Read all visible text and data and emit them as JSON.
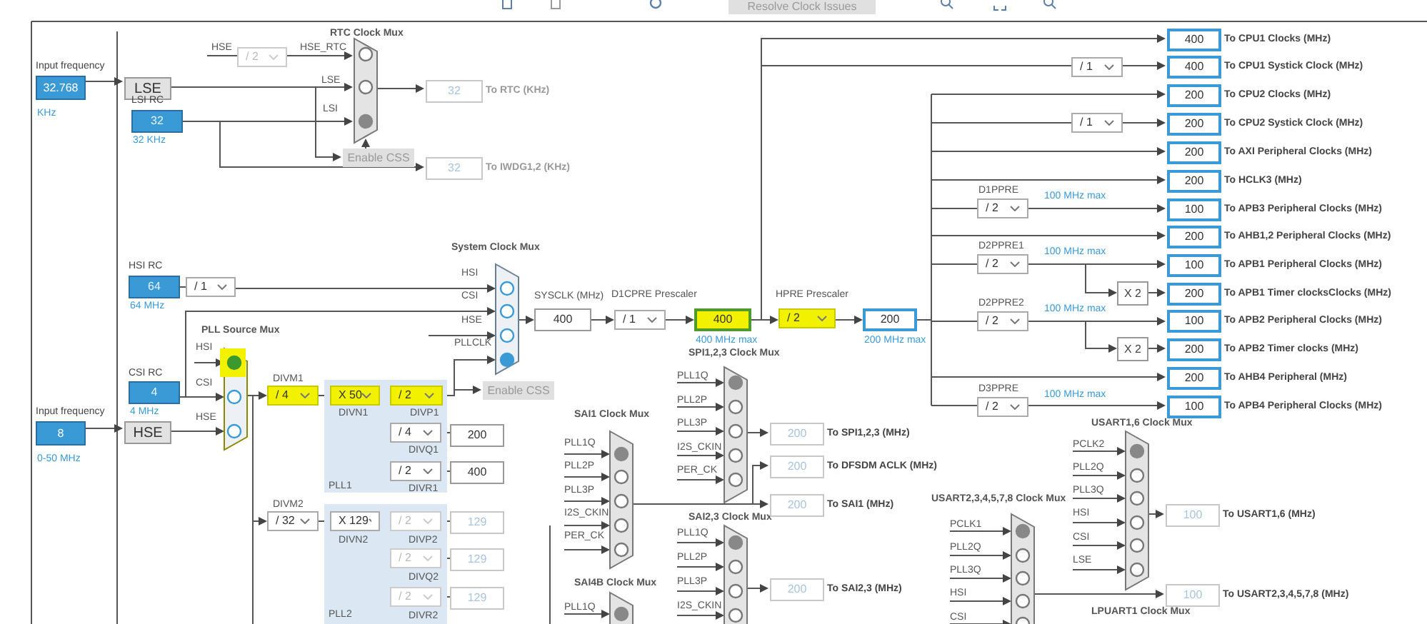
{
  "toolbar": {
    "resolve_button": "Resolve Clock Issues"
  },
  "inputs": [
    {
      "label": "Input frequency",
      "value": "32.768",
      "unit": "KHz"
    },
    {
      "label": "Input frequency",
      "value": "8",
      "unit": "0-50 MHz"
    }
  ],
  "sources": [
    "LSE",
    "HSE"
  ],
  "oscillators": [
    {
      "label": "LSI RC",
      "value": "32",
      "unit": "32 KHz"
    },
    {
      "label": "HSI RC",
      "value": "64",
      "unit": "64 MHz"
    },
    {
      "label": "CSI RC",
      "value": "4",
      "unit": "4 MHz"
    }
  ],
  "muxes": [
    {
      "title": "RTC Clock Mux",
      "enabled": false,
      "highlighted": false,
      "inputs": [
        {
          "label": "HSE_RTC",
          "selected": false
        },
        {
          "label": "LSE",
          "selected": false
        },
        {
          "label": "LSI",
          "selected": true
        }
      ]
    },
    {
      "title": "System Clock Mux",
      "enabled": true,
      "highlighted": false,
      "inputs": [
        {
          "label": "HSI",
          "selected": false
        },
        {
          "label": "CSI",
          "selected": false
        },
        {
          "label": "HSE",
          "selected": false
        },
        {
          "label": "PLLCLK",
          "selected": true
        }
      ]
    },
    {
      "title": "PLL Source Mux",
      "enabled": true,
      "highlighted": true,
      "inputs": [
        {
          "label": "HSI",
          "selected": true
        },
        {
          "label": "CSI",
          "selected": false
        },
        {
          "label": "HSE",
          "selected": false
        }
      ]
    },
    {
      "title": "SPI1,2,3 Clock Mux",
      "enabled": false,
      "highlighted": false,
      "inputs": [
        {
          "label": "PLL1Q",
          "selected": true
        },
        {
          "label": "PLL2P",
          "selected": false
        },
        {
          "label": "PLL3P",
          "selected": false
        },
        {
          "label": "I2S_CKIN",
          "selected": false
        },
        {
          "label": "PER_CK",
          "selected": false
        }
      ]
    },
    {
      "title": "SAI1 Clock Mux",
      "enabled": false,
      "highlighted": false,
      "inputs": [
        {
          "label": "PLL1Q",
          "selected": true
        },
        {
          "label": "PLL2P",
          "selected": false
        },
        {
          "label": "PLL3P",
          "selected": false
        },
        {
          "label": "I2S_CKIN",
          "selected": false
        },
        {
          "label": "PER_CK",
          "selected": false
        }
      ]
    },
    {
      "title": "SAI4B Clock Mux",
      "enabled": false,
      "highlighted": false,
      "inputs": [
        {
          "label": "PLL1Q",
          "selected": true
        }
      ]
    },
    {
      "title": "SAI2,3 Clock Mux",
      "enabled": false,
      "highlighted": false,
      "inputs": [
        {
          "label": "PLL1Q",
          "selected": true
        },
        {
          "label": "PLL2P",
          "selected": false
        },
        {
          "label": "PLL3P",
          "selected": false
        },
        {
          "label": "I2S_CKIN",
          "selected": false
        }
      ]
    },
    {
      "title": "USART1,6 Clock Mux",
      "enabled": false,
      "highlighted": false,
      "inputs": [
        {
          "label": "PCLK2",
          "selected": true
        },
        {
          "label": "PLL2Q",
          "selected": false
        },
        {
          "label": "PLL3Q",
          "selected": false
        },
        {
          "label": "HSI",
          "selected": false
        },
        {
          "label": "CSI",
          "selected": false
        },
        {
          "label": "LSE",
          "selected": false
        }
      ]
    },
    {
      "title": "USART2,3,4,5,7,8 Clock Mux",
      "enabled": false,
      "highlighted": false,
      "inputs": [
        {
          "label": "PCLK1",
          "selected": true
        },
        {
          "label": "PLL2Q",
          "selected": false
        },
        {
          "label": "PLL3Q",
          "selected": false
        },
        {
          "label": "HSI",
          "selected": false
        },
        {
          "label": "CSI",
          "selected": false
        }
      ]
    },
    {
      "title": "LPUART1 Clock Mux"
    }
  ],
  "prescalers": [
    {
      "value": "/ 2",
      "kind": "disabled"
    },
    {
      "value": "/ 1",
      "kind": "normal"
    },
    {
      "label": "DIVM1",
      "value": "/ 4",
      "kind": "highlighted"
    },
    {
      "label": "DIVN1",
      "value": "X 50",
      "kind": "highlighted"
    },
    {
      "label": "DIVP1",
      "value": "/ 2",
      "kind": "highlighted"
    },
    {
      "label": "DIVQ1",
      "value": "/ 4",
      "kind": "normal"
    },
    {
      "label": "DIVR1",
      "value": "/ 2",
      "kind": "normal"
    },
    {
      "label": "DIVM2",
      "value": "/ 32",
      "kind": "normal"
    },
    {
      "label": "DIVN2",
      "value": "X 129",
      "kind": "normal"
    },
    {
      "label": "DIVP2",
      "value": "/ 2",
      "kind": "disabled"
    },
    {
      "label": "DIVQ2",
      "value": "/ 2",
      "kind": "disabled"
    },
    {
      "label": "DIVR2",
      "value": "/ 2",
      "kind": "disabled"
    },
    {
      "label": "D1CPRE Prescaler",
      "value": "/ 1",
      "kind": "normal"
    },
    {
      "label": "HPRE Prescaler",
      "value": "/ 2",
      "kind": "highlighted"
    },
    {
      "value": "/ 1",
      "kind": "normal"
    },
    {
      "value": "/ 1",
      "kind": "normal"
    },
    {
      "label": "D1PPRE",
      "value": "/ 2",
      "kind": "normal"
    },
    {
      "label": "D2PPRE1",
      "value": "/ 2",
      "kind": "normal"
    },
    {
      "label": "D2PPRE2",
      "value": "/ 2",
      "kind": "normal"
    },
    {
      "label": "D3PPRE",
      "value": "/ 2",
      "kind": "normal"
    }
  ],
  "outputs": [
    {
      "value": "32",
      "kind": "inactive",
      "label": "To RTC (KHz)"
    },
    {
      "value": "32",
      "kind": "inactive",
      "label": "To IWDG1,2 (KHz)"
    },
    {
      "value": "200",
      "kind": "plain"
    },
    {
      "value": "400",
      "kind": "plain"
    },
    {
      "value": "129",
      "kind": "inactive"
    },
    {
      "value": "129",
      "kind": "inactive"
    },
    {
      "value": "129",
      "kind": "inactive"
    },
    {
      "value": "400",
      "kind": "plain",
      "label": "SYSCLK (MHz)"
    },
    {
      "value": "400",
      "kind": "highlighted",
      "note": "400 MHz max"
    },
    {
      "value": "200",
      "kind": "active",
      "note": "200 MHz max"
    },
    {
      "value": "400",
      "kind": "active",
      "label": "To CPU1 Clocks (MHz)"
    },
    {
      "value": "400",
      "kind": "active",
      "label": "To CPU1 Systick Clock (MHz)"
    },
    {
      "value": "200",
      "kind": "active",
      "label": "To CPU2 Clocks (MHz)"
    },
    {
      "value": "200",
      "kind": "active",
      "label": "To CPU2 Systick Clock (MHz)"
    },
    {
      "value": "200",
      "kind": "active",
      "label": "To AXI Peripheral Clocks (MHz)"
    },
    {
      "value": "200",
      "kind": "active",
      "label": "To HCLK3 (MHz)"
    },
    {
      "value": "100",
      "kind": "active",
      "label": "To APB3 Peripheral Clocks (MHz)"
    },
    {
      "value": "200",
      "kind": "active",
      "label": "To AHB1,2 Peripheral Clocks (MHz)"
    },
    {
      "value": "100",
      "kind": "active",
      "label": "To APB1 Peripheral Clocks (MHz)"
    },
    {
      "value": "200",
      "kind": "active",
      "label": "To APB1 Timer clocksClocks (MHz)"
    },
    {
      "value": "100",
      "kind": "active",
      "label": "To APB2 Peripheral Clocks (MHz)"
    },
    {
      "value": "200",
      "kind": "active",
      "label": "To APB2 Timer clocks (MHz)"
    },
    {
      "value": "200",
      "kind": "active",
      "label": "To AHB4 Peripheral (MHz)"
    },
    {
      "value": "100",
      "kind": "active",
      "label": "To APB4 Peripheral Clocks (MHz)"
    },
    {
      "value": "200",
      "kind": "inactive",
      "label": "To SPI1,2,3 (MHz)"
    },
    {
      "value": "200",
      "kind": "inactive",
      "label": "To DFSDM ACLK (MHz)"
    },
    {
      "value": "200",
      "kind": "inactive",
      "label": "To SAI1 (MHz)"
    },
    {
      "value": "200",
      "kind": "inactive",
      "label": "To SAI2,3 (MHz)"
    },
    {
      "value": "100",
      "kind": "inactive",
      "label": "To USART1,6 (MHz)"
    },
    {
      "value": "100",
      "kind": "inactive",
      "label": "To USART2,3,4,5,7,8 (MHz)"
    }
  ],
  "multipliers": [
    "X 2",
    "X 2"
  ],
  "css_buttons": [
    "Enable CSS",
    "Enable CSS"
  ],
  "labels": [
    {
      "text": "HSE",
      "kind": "wire"
    },
    {
      "text": "PLL1",
      "kind": "caption"
    },
    {
      "text": "PLL2",
      "kind": "caption"
    },
    {
      "text": "100 MHz max",
      "kind": "note"
    },
    {
      "text": "100 MHz max",
      "kind": "note"
    },
    {
      "text": "100 MHz max",
      "kind": "note"
    },
    {
      "text": "100 MHz max",
      "kind": "note"
    }
  ]
}
